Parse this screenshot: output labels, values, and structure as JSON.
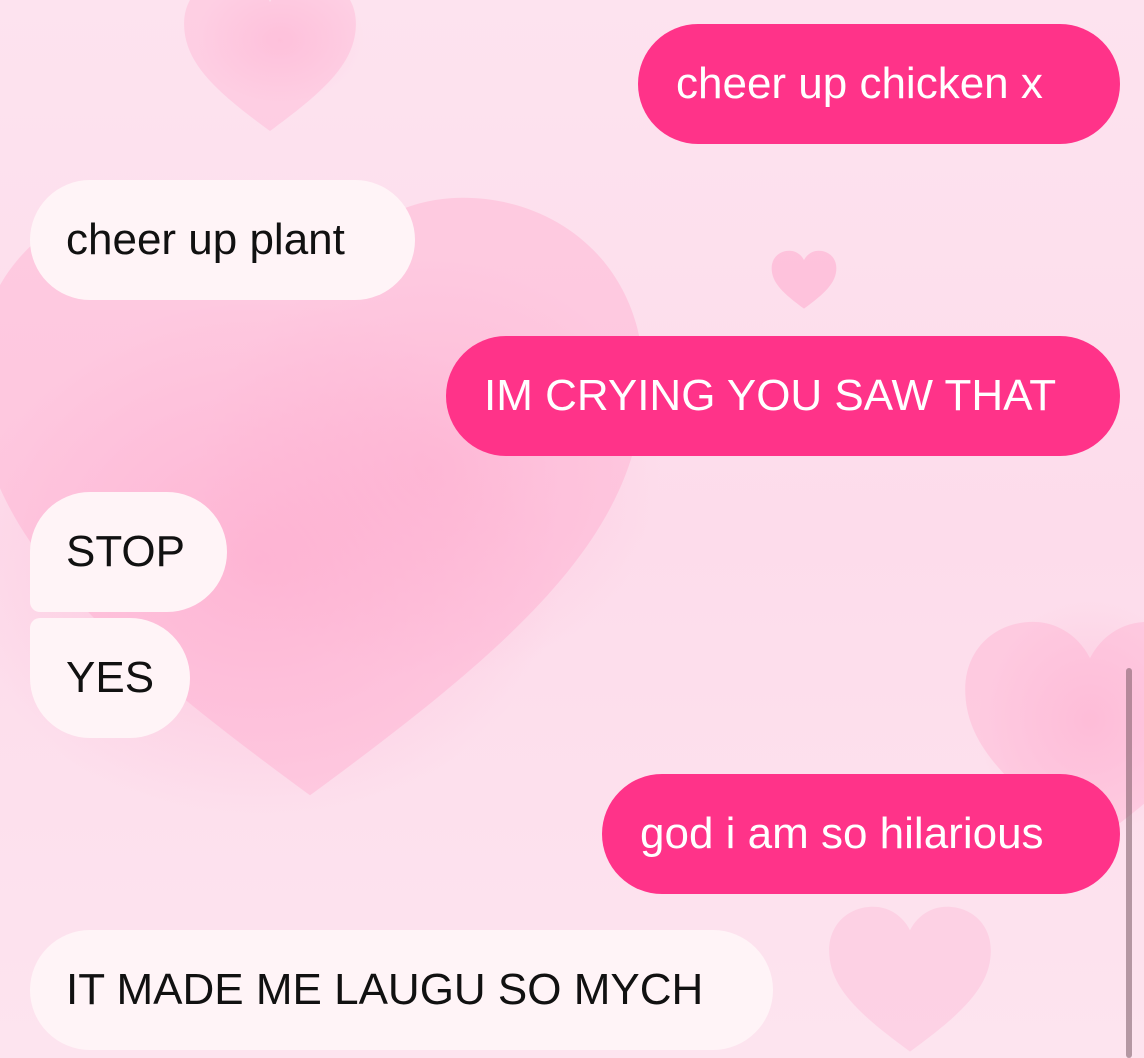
{
  "chat": {
    "messages": [
      {
        "text": "cheer up chicken x",
        "direction": "sent"
      },
      {
        "text": "cheer up plant",
        "direction": "received"
      },
      {
        "text": "IM CRYING YOU SAW THAT",
        "direction": "sent"
      },
      {
        "text": "STOP",
        "direction": "received"
      },
      {
        "text": "YES",
        "direction": "received"
      },
      {
        "text": "god i am so hilarious",
        "direction": "sent"
      },
      {
        "text": "IT MADE ME LAUGU SO MYCH",
        "direction": "received"
      }
    ]
  },
  "colors": {
    "sent_bubble": "#ff3389",
    "received_bubble": "#fff4f7",
    "background": "#fde3ef"
  }
}
